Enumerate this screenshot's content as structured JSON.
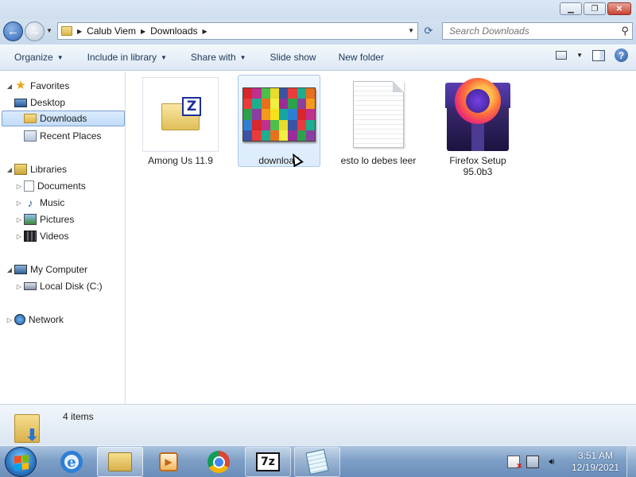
{
  "window": {
    "minimize": "▁",
    "maximize": "❐",
    "close": "✕"
  },
  "address": {
    "crumbs": [
      "Calub Viem",
      "Downloads"
    ],
    "search_placeholder": "Search Downloads"
  },
  "toolbar": {
    "organize": "Organize",
    "include_in_library": "Include in library",
    "share_with": "Share with",
    "slide_show": "Slide show",
    "new_folder": "New folder"
  },
  "sidebar": {
    "favorites": {
      "label": "Favorites",
      "items": [
        {
          "label": "Desktop",
          "icon": "desktop-icon"
        },
        {
          "label": "Downloads",
          "icon": "downloads-folder-icon",
          "selected": true
        },
        {
          "label": "Recent Places",
          "icon": "recent-places-icon"
        }
      ]
    },
    "libraries": {
      "label": "Libraries",
      "items": [
        {
          "label": "Documents",
          "icon": "documents-icon"
        },
        {
          "label": "Music",
          "icon": "music-icon"
        },
        {
          "label": "Pictures",
          "icon": "pictures-icon"
        },
        {
          "label": "Videos",
          "icon": "videos-icon"
        }
      ]
    },
    "computer": {
      "label": "My Computer",
      "items": [
        {
          "label": "Local Disk (C:)",
          "icon": "local-disk-icon"
        }
      ]
    },
    "network": {
      "label": "Network"
    }
  },
  "files": [
    {
      "name": "Among Us 11.9",
      "type": "zip-archive",
      "icon": "7zip-archive-icon"
    },
    {
      "name": "download",
      "type": "image",
      "icon": "image-thumbnail",
      "selected": true
    },
    {
      "name": "esto lo debes leer",
      "type": "text",
      "icon": "text-document-icon"
    },
    {
      "name": "Firefox Setup 95.0b3",
      "type": "installer",
      "icon": "firefox-installer-icon"
    }
  ],
  "thumbnail_letters": [
    "b",
    "c",
    "d",
    "e",
    "f",
    "g",
    "h",
    "i",
    "j",
    "k",
    "l",
    "m",
    "n",
    "o",
    "p",
    "q",
    "r",
    "s",
    "t",
    "u",
    "v",
    "w",
    "x",
    "y",
    "z",
    "1",
    "2",
    "3",
    "4",
    "5",
    "6",
    "7",
    "8",
    "9",
    "0",
    "a",
    "b",
    "c",
    "d",
    "e"
  ],
  "thumbnail_colors": [
    "#d8262b",
    "#f7e218",
    "#2aa34a",
    "#e86f1c",
    "#3a53a4",
    "#c12f8f",
    "#16a6a0",
    "#8c3fa0",
    "#f0f040",
    "#e93b3b",
    "#4cbf4c",
    "#2d7fd3",
    "#f49a1c",
    "#9a2c9a",
    "#1cae8e",
    "#e6dc2b"
  ],
  "details": {
    "count": "4 items"
  },
  "taskbar": {
    "apps": [
      {
        "name": "Windows Explorer",
        "state": "active"
      },
      {
        "name": "Internet Explorer"
      },
      {
        "name": "Windows Media Player"
      },
      {
        "name": "Google Chrome"
      },
      {
        "name": "7-Zip",
        "state": "open"
      },
      {
        "name": "Notepad",
        "state": "open"
      }
    ],
    "time": "3:51 AM",
    "date": "12/19/2021"
  }
}
